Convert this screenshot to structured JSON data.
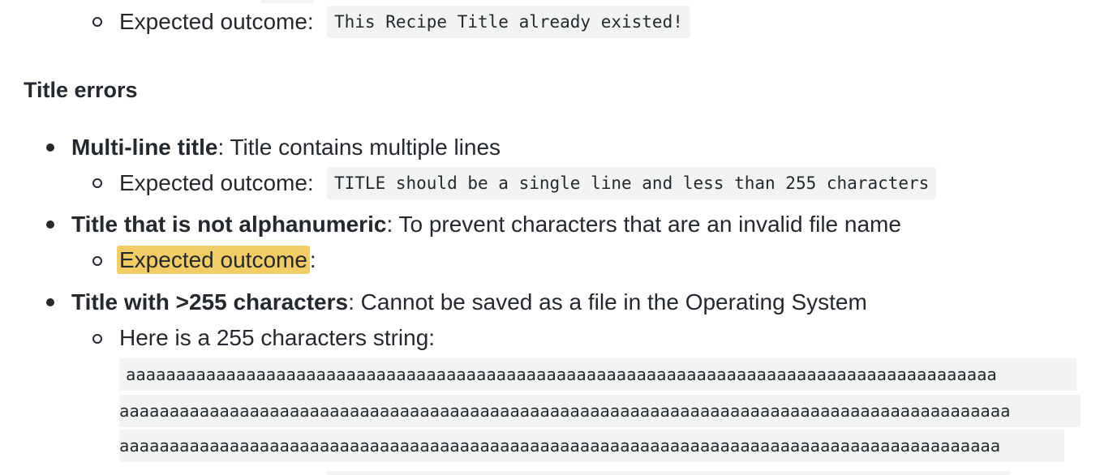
{
  "sections": {
    "prev_outcome": {
      "label": "Expected outcome:",
      "code": "This Recipe Title already existed!"
    },
    "title_errors_heading": "Title errors",
    "items": [
      {
        "term": "Multi-line title",
        "desc": ": Title contains multiple lines",
        "outcome_label": "Expected outcome:",
        "outcome_code": "TITLE should be a single line and less than 255 characters"
      },
      {
        "term": "Title that is not alphanumeric",
        "desc": ": To prevent characters that are an invalid file name",
        "outcome_label_highlighted": "Expected outcome",
        "outcome_suffix": ":"
      },
      {
        "term": "Title with >255 characters",
        "desc": ": Cannot be saved as a file in the Operating System",
        "sub_label": "Here is a 255 characters string:",
        "long_lines": [
          "aaaaaaaaaaaaaaaaaaaaaaaaaaaaaaaaaaaaaaaaaaaaaaaaaaaaaaaaaaaaaaaaaaaaaaaaaaaaaaaaaaaaaaa",
          "aaaaaaaaaaaaaaaaaaaaaaaaaaaaaaaaaaaaaaaaaaaaaaaaaaaaaaaaaaaaaaaaaaaaaaaaaaaaaaaaaaaaaaaaa",
          "aaaaaaaaaaaaaaaaaaaaaaaaaaaaaaaaaaaaaaaaaaaaaaaaaaaaaaaaaaaaaaaaaaaaaaaaaaaaaaaaaaaaaaaa"
        ]
      }
    ]
  },
  "colors": {
    "highlight": "#f2cd66",
    "code_bg": "#f2f3f3",
    "text": "#24292f"
  }
}
